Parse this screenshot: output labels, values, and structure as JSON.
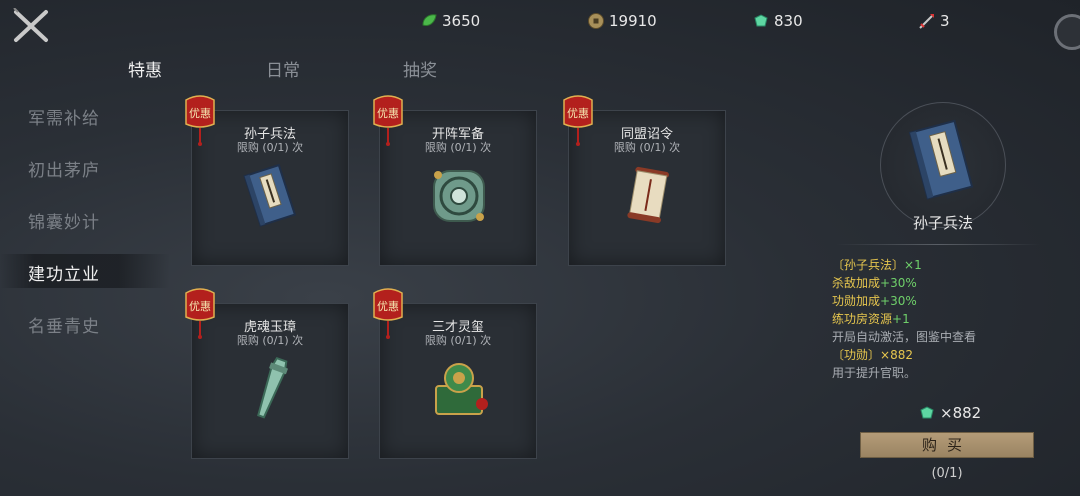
{
  "currencies": [
    {
      "icon": "jade-leaf-icon",
      "value": "3650"
    },
    {
      "icon": "copper-coin-icon",
      "value": "19910"
    },
    {
      "icon": "merit-token-icon",
      "value": "830"
    },
    {
      "icon": "arrow-token-icon",
      "value": "3"
    }
  ],
  "tabs": [
    "特惠",
    "日常",
    "抽奖"
  ],
  "sidebar": [
    "军需补给",
    "初出茅庐",
    "锦囊妙计",
    "建功立业",
    "名垂青史"
  ],
  "badge_text": "优惠",
  "items": [
    {
      "name": "孙子兵法",
      "limit": "限购 (0/1) 次",
      "icon": "book-icon"
    },
    {
      "name": "开阵军备",
      "limit": "限购 (0/1) 次",
      "icon": "jade-medallion-icon"
    },
    {
      "name": "同盟诏令",
      "limit": "限购 (0/1) 次",
      "icon": "scroll-icon"
    },
    {
      "name": "虎魂玉璋",
      "limit": "限购 (0/1) 次",
      "icon": "jade-blade-icon"
    },
    {
      "name": "三才灵玺",
      "limit": "限购 (0/1) 次",
      "icon": "dragon-seal-icon"
    }
  ],
  "detail": {
    "name": "孙子兵法",
    "item_line_name": "〔孙子兵法〕",
    "item_line_qty": "×1",
    "stat1_label": "杀敌加成",
    "stat1_value": "+30%",
    "stat2_label": "功勋加成",
    "stat2_value": "+30%",
    "stat3_label": "练功房资源",
    "stat3_value": "+1",
    "note": "开局自动激活，图鉴中查看",
    "merit_label": "〔功勋〕",
    "merit_qty": "×882",
    "merit_note": "用于提升官职。",
    "price": "×882",
    "buy_label": "购买",
    "buy_count": "(0/1)"
  },
  "colors": {
    "highlight_yellow": "#e6c64e",
    "highlight_green": "#6fd06a",
    "badge_red": "#b3201d",
    "buy_button": "#a89070"
  }
}
